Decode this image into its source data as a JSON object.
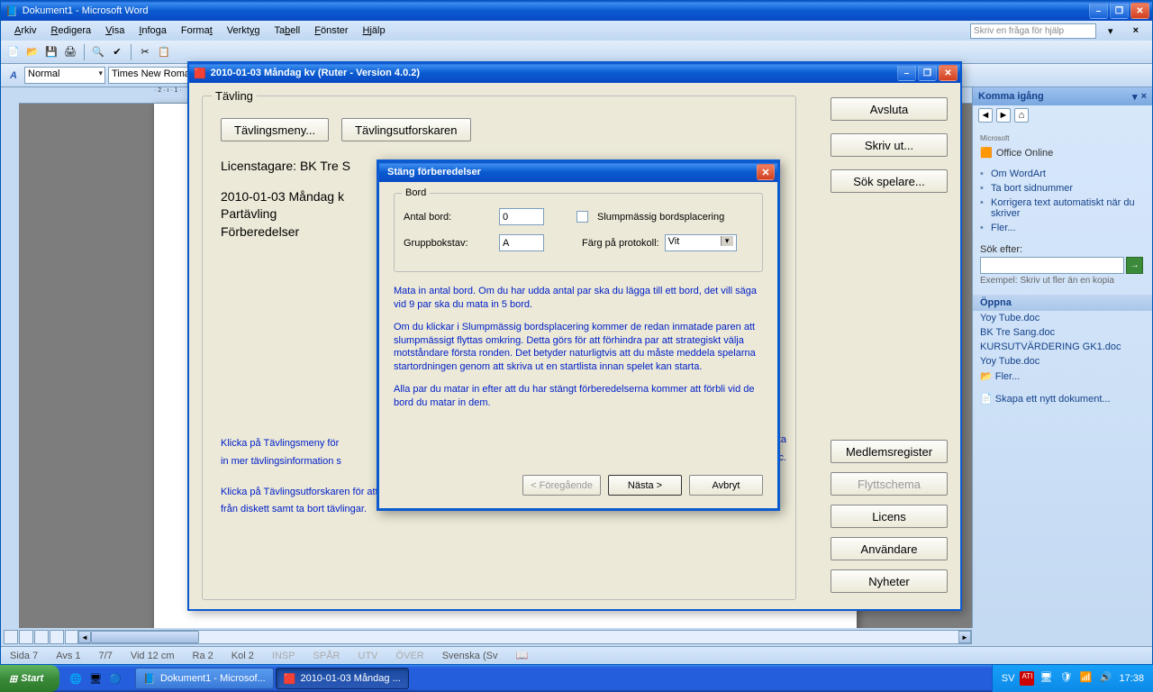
{
  "word": {
    "title": "Dokument1 - Microsoft Word",
    "menus": {
      "arkiv": "Arkiv",
      "redigera": "Redigera",
      "visa": "Visa",
      "infoga": "Infoga",
      "format": "Format",
      "verktyg": "Verktyg",
      "tabell": "Tabell",
      "fonster": "Fönster",
      "hjalp": "Hjälp"
    },
    "help_placeholder": "Skriv en fråga för hjälp",
    "style": "Normal",
    "font": "Times New Roman",
    "ruler_marks": "· 2 · ı · 1 ·",
    "status": {
      "sida": "Sida  7",
      "avs": "Avs  1",
      "seq": "7/7",
      "vid": "Vid  12 cm",
      "ra": "Ra  2",
      "kol": "Kol  2",
      "insp": "INSP",
      "spar": "SPÅR",
      "utv": "UTV",
      "over": "ÖVER",
      "lang": "Svenska (Sv"
    }
  },
  "task_pane": {
    "title": "Komma igång",
    "office": "Office Online",
    "office_prefix": "Microsoft",
    "links": {
      "l1": "Om WordArt",
      "l2": "Ta bort sidnummer",
      "l3": "Korrigera text automatiskt när du skriver",
      "l4": "Fler..."
    },
    "search_label": "Sök efter:",
    "example": "Exempel:  Skriv ut fler än en kopia",
    "open": "Öppna",
    "files": {
      "f1": "Yoy Tube.doc",
      "f2": "BK Tre Sang.doc",
      "f3": "KURSUTVÄRDERING GK1.doc",
      "f4": "Yoy Tube.doc",
      "more": "Fler..."
    },
    "new_doc": "Skapa ett nytt dokument..."
  },
  "ruter": {
    "title": "2010-01-03  Måndag kv  (Ruter - Version 4.0.2)",
    "grp_tavling": "Tävling",
    "btns": {
      "meny": "Tävlingsmeny...",
      "utforsk": "Tävlingsutforskaren",
      "avsluta": "Avsluta",
      "skriv": "Skriv ut...",
      "sok": "Sök spelare...",
      "medlems": "Medlemsregister",
      "flytt": "Flyttschema",
      "licens": "Licens",
      "anvandare": "Användare",
      "nyheter": "Nyheter"
    },
    "licensee": "Licenstagare: BK Tre S",
    "line1": "2010-01-03  Måndag k",
    "line2": "Partävling",
    "line3": "Förberedelser",
    "blue1": "Klicka på Tävlingsmeny för",
    "blue1b": "in mer tävlingsinformation s",
    "blue1c": "ta",
    "blue1d": "etc.",
    "blue2": "Klicka på Tävlingsutforskaren för att starta nya tävlingar eller öppna beräknade tävlingar. Du kan också flytta tävlingar till och från diskett samt ta bort tävlingar."
  },
  "dlg": {
    "title": "Stäng förberedelser",
    "grp": "Bord",
    "antal": "Antal bord:",
    "antal_val": "0",
    "slump": "Slumpmässig bordsplacering",
    "grupp": "Gruppbokstav:",
    "grupp_val": "A",
    "farg": "Färg på protokoll:",
    "farg_val": "Vit",
    "p1": "Mata in antal bord. Om du har udda antal par ska du lägga till ett bord, det vill säga vid 9 par ska du mata in 5 bord.",
    "p2": "Om du klickar i Slumpmässig bordsplacering kommer de redan inmatade paren att slumpmässigt flyttas omkring. Detta görs för att förhindra par att strategiskt välja motståndare första ronden. Det betyder naturligtvis att du måste meddela spelarna startordningen genom att skriva ut en startlista innan spelet kan starta.",
    "p3": "Alla par du matar in efter att du har stängt förberedelserna kommer att förbli vid de bord du matar in dem.",
    "prev": "< Föregående",
    "next": "Nästa >",
    "cancel": "Avbryt"
  },
  "taskbar": {
    "start": "Start",
    "task1": "Dokument1 - Microsof...",
    "task2": "2010-01-03  Måndag ...",
    "lang": "SV",
    "clock": "17:38"
  }
}
